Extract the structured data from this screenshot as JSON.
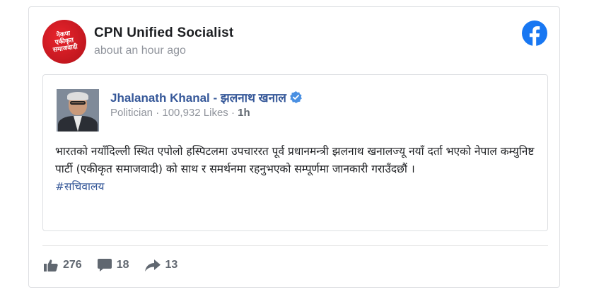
{
  "post": {
    "page_name": "CPN Unified Socialist",
    "timestamp": "about an hour ago",
    "avatar_logo_text": "नेकपा एकीकृत समाजवादी"
  },
  "shared": {
    "author": "Jhalanath Khanal - झलनाथ खनाल",
    "category": "Politician",
    "likes": "100,932 Likes",
    "time": "1h",
    "body_text": "भारतको नयाँदिल्ली स्थित एपोलो हस्पिटलमा उपचाररत पूर्व प्रधानमन्त्री झलनाथ खनालज्यू नयाँ दर्ता भएको नेपाल कम्युनिष्ट पार्टी (एकीकृत समाजवादी) को साथ र समर्थनमा रहनुभएको सम्पूर्णमा जानकारी गराउँदछौं ।",
    "hashtag": "#सचिवालय"
  },
  "stats": {
    "likes": "276",
    "comments": "18",
    "shares": "13"
  },
  "icons": {
    "facebook": "facebook-icon",
    "verified": "verified-badge-icon",
    "like": "thumbs-up-icon",
    "comment": "comment-icon",
    "share": "share-arrow-icon"
  },
  "colors": {
    "facebook_blue": "#1877f2",
    "link_blue": "#365899",
    "muted": "#90949c",
    "logo_red": "#d31820"
  }
}
